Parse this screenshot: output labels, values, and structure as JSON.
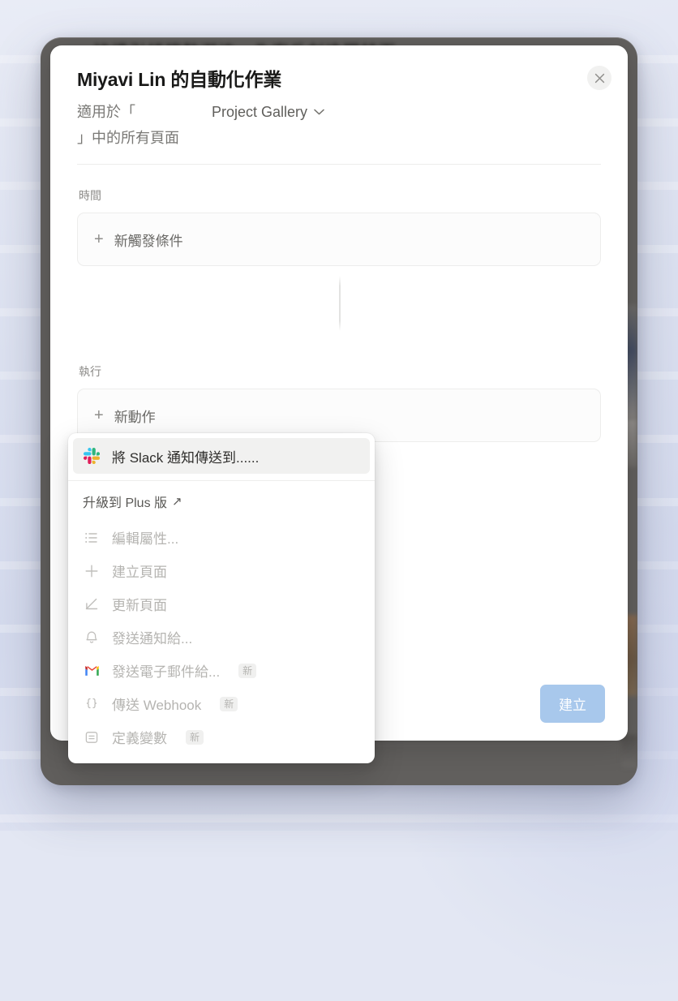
{
  "background": {
    "blurred_page_text": "⋯⋯ 持續引領趨勢潮流，為客戶創造獨特而",
    "accent_surface": "#d7dcee"
  },
  "modal": {
    "title": "Miyavi Lin 的自動化作業",
    "subtitle_prefix": "適用於「",
    "subtitle_suffix": "」中的所有頁面",
    "scope_value": "Project Gallery",
    "close_icon": "close-icon",
    "sections": {
      "trigger": {
        "label": "時間",
        "add_label": "新觸發條件",
        "plus_icon": "plus-icon"
      },
      "action": {
        "label": "執行",
        "add_label": "新動作",
        "plus_icon": "plus-icon"
      }
    },
    "footer": {
      "create_label": "建立",
      "create_color": "#a8c8ec"
    }
  },
  "action_menu": {
    "selected_item": {
      "label": "將 Slack 通知傳送到......",
      "icon": "slack-icon"
    },
    "upgrade": {
      "label": "升級到 Plus 版",
      "arrow": "↗",
      "icon": "external-link-arrow-icon"
    },
    "items": [
      {
        "label": "編輯屬性...",
        "icon": "list-icon",
        "badge": ""
      },
      {
        "label": "建立頁面",
        "icon": "plus-icon",
        "badge": ""
      },
      {
        "label": "更新頁面",
        "icon": "pencil-icon",
        "badge": ""
      },
      {
        "label": "發送通知給...",
        "icon": "bell-icon",
        "badge": ""
      },
      {
        "label": "發送電子郵件給...",
        "icon": "gmail-icon",
        "badge": "新"
      },
      {
        "label": "傳送 Webhook",
        "icon": "braces-icon",
        "badge": "新"
      },
      {
        "label": "定義變數",
        "icon": "variable-box-icon",
        "badge": "新"
      }
    ]
  }
}
